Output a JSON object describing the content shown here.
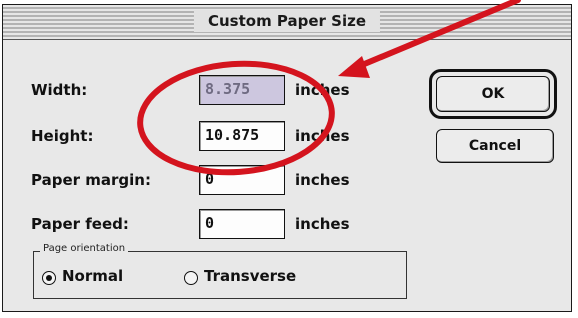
{
  "dialog": {
    "title": "Custom Paper Size"
  },
  "form": {
    "width": {
      "label": "Width:",
      "value": "8.375",
      "unit": "inches"
    },
    "height": {
      "label": "Height:",
      "value": "10.875",
      "unit": "inches"
    },
    "paper_margin": {
      "label": "Paper margin:",
      "value": "0",
      "unit": "inches"
    },
    "paper_feed": {
      "label": "Paper feed:",
      "value": "0",
      "unit": "inches"
    }
  },
  "buttons": {
    "ok_label": "OK",
    "cancel_label": "Cancel"
  },
  "orientation": {
    "group_label": "Page orientation",
    "options": [
      {
        "label": "Normal",
        "selected": true
      },
      {
        "label": "Transverse",
        "selected": false
      }
    ]
  },
  "annotation": {
    "color": "#d4141e"
  }
}
